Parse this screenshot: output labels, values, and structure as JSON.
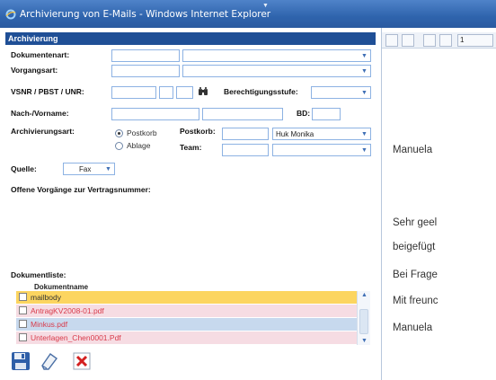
{
  "window": {
    "title": "Archivierung von E-Mails - Windows Internet Explorer"
  },
  "panel": {
    "title": "Archivierung"
  },
  "form": {
    "dokumentenart_label": "Dokumentenart:",
    "vorgangsart_label": "Vorgangsart:",
    "vsnr_label": "VSNR / PBST / UNR:",
    "berechtigungsstufe_label": "Berechtigungsstufe:",
    "name_label": "Nach-/Vorname:",
    "bd_label": "BD:",
    "archivierungsart_label": "Archivierungsart:",
    "option_postkorb": "Postkorb",
    "option_ablage": "Ablage",
    "archivierungsart_selected": "Postkorb",
    "postkorb_label": "Postkorb:",
    "postkorb_value": "Huk Monika",
    "team_label": "Team:",
    "quelle_label": "Quelle:",
    "quelle_value": "Fax",
    "offene_label": "Offene Vorgänge zur Vertragsnummer:"
  },
  "doclist": {
    "label": "Dokumentliste:",
    "column": "Dokumentname",
    "rows": [
      "mailbody",
      "AntragKV2008-01.pdf",
      "Minkus.pdf",
      "Unterlagen_Chen0001.Pdf"
    ]
  },
  "actions": [
    "save-icon",
    "eraser-icon",
    "delete-icon"
  ],
  "viewer": {
    "page_indicator": "1",
    "lines": [
      "Manuela",
      "Sehr geel",
      "beigefügt",
      "Bei Frage",
      "Mit freunc",
      "Manuela"
    ]
  },
  "colors": {
    "titlebar": "#2f64ad",
    "panel_header": "#1f4f96",
    "field_border": "#8db2e3",
    "row_selected": "#fcd560",
    "row_pink": "#f6dce3",
    "row_blue": "#c7d9ee",
    "link_red": "#d83a4a"
  }
}
